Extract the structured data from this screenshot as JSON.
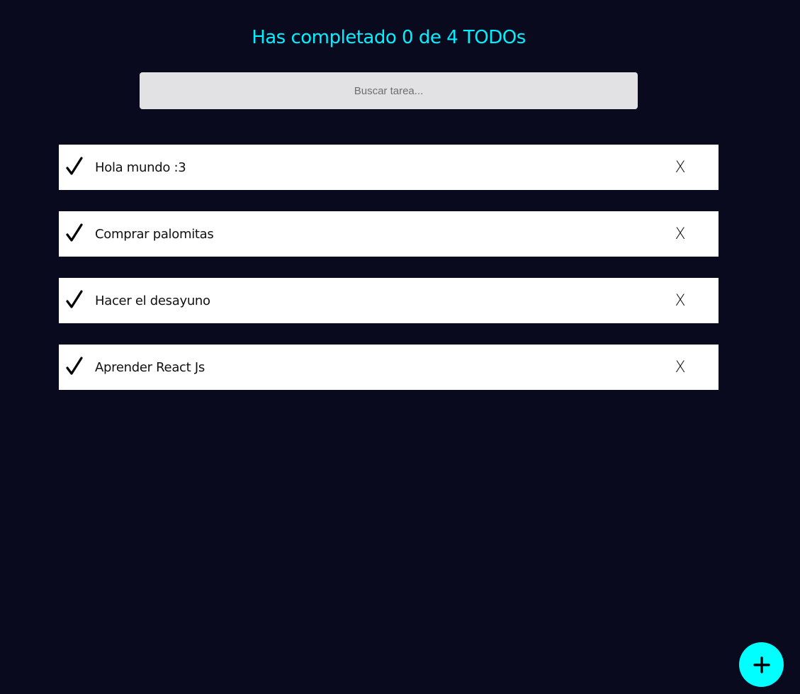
{
  "header": {
    "counter_text": "Has completado 0 de 4 TODOs"
  },
  "search": {
    "placeholder": "Buscar tarea...",
    "value": ""
  },
  "todos": [
    {
      "text": "Hola mundo :3",
      "completed": false,
      "delete_label": "X"
    },
    {
      "text": "Comprar palomitas",
      "completed": false,
      "delete_label": "X"
    },
    {
      "text": "Hacer el desayuno",
      "completed": false,
      "delete_label": "X"
    },
    {
      "text": "Aprender React Js",
      "completed": false,
      "delete_label": "X"
    }
  ],
  "icons": {
    "complete": "check-icon",
    "delete": "close-icon",
    "add": "plus-icon"
  },
  "colors": {
    "background": "#0a0a1e",
    "accent": "#00ffff",
    "title": "#00f0ff",
    "todo_background": "#ffffff",
    "search_background": "#e2e1e4"
  }
}
